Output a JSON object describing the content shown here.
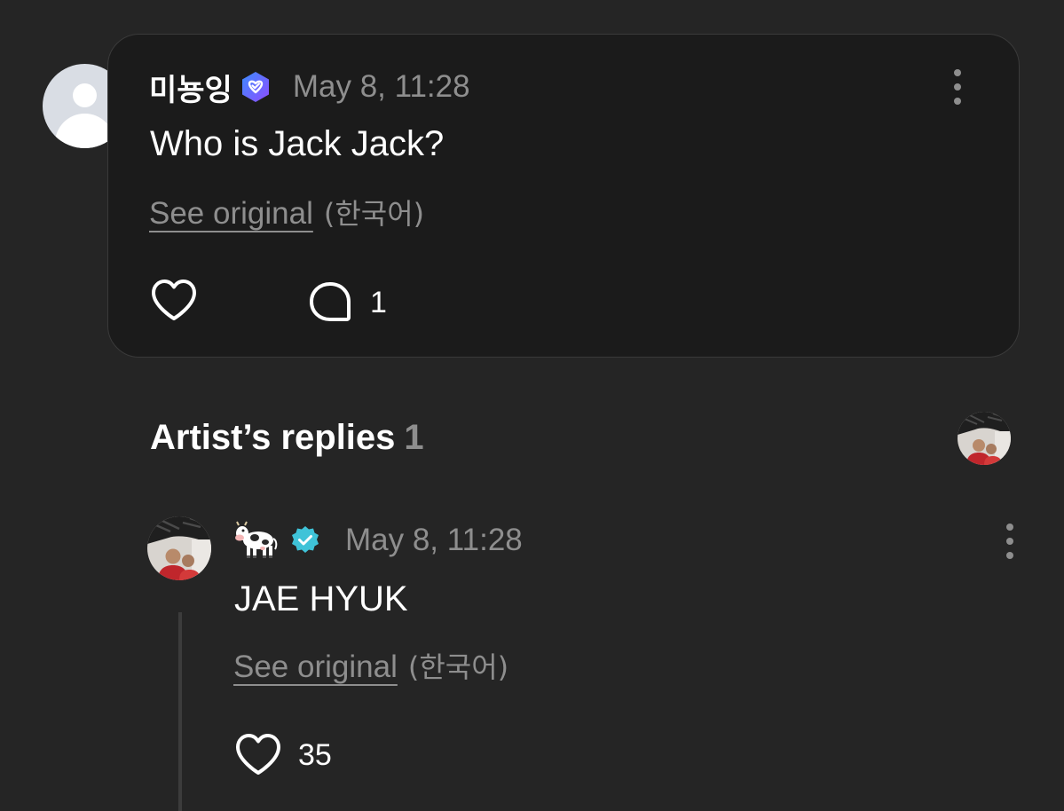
{
  "comment": {
    "username": "미뇽잉",
    "timestamp": "May 8, 11:28",
    "text": "Who is Jack Jack?",
    "see_original_label": "See original",
    "language_label": "(한국어)",
    "reply_count": "1"
  },
  "artist_replies": {
    "heading": "Artist’s replies",
    "count": "1"
  },
  "reply": {
    "username_icon": "cow-emoji",
    "timestamp": "May 8, 11:28",
    "text": "JAE HYUK",
    "see_original_label": "See original",
    "language_label": "(한국어)",
    "like_count": "35"
  },
  "colors": {
    "background": "#252525",
    "card": "#1b1b1b",
    "muted_text": "#8e8e8e",
    "verified_purple": "#6e5cf6",
    "verified_blue": "#3fc3d8"
  }
}
